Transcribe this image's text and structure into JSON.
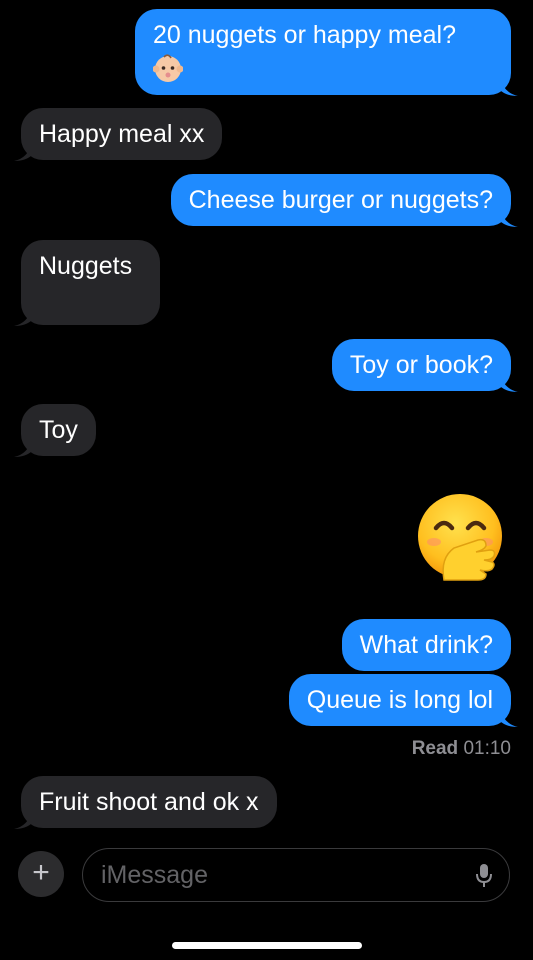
{
  "conversation": {
    "messages": [
      {
        "direction": "sent",
        "text": "20 nuggets or happy meal?",
        "emoji": "baby-face"
      },
      {
        "direction": "received",
        "text": "Happy meal xx"
      },
      {
        "direction": "sent",
        "text": "Cheese burger or nuggets?"
      },
      {
        "direction": "received",
        "text": "Nuggets"
      },
      {
        "direction": "sent",
        "text": "Toy or book?"
      },
      {
        "direction": "received",
        "text": "Toy"
      },
      {
        "direction": "sent",
        "emoji": "face-with-hand-over-mouth"
      },
      {
        "direction": "sent",
        "text": "What drink?"
      },
      {
        "direction": "sent",
        "text": "Queue is long lol"
      },
      {
        "direction": "received",
        "text": "Fruit shoot and ok x"
      }
    ],
    "read_receipt": {
      "label": "Read",
      "time": "01:10"
    }
  },
  "composer": {
    "plus_icon": "plus-icon",
    "placeholder": "iMessage",
    "mic_icon": "microphone-icon"
  },
  "colors": {
    "background": "#000000",
    "sent_bubble": "#1f8bff",
    "received_bubble": "#262629",
    "secondary_text": "#8e8e93"
  }
}
